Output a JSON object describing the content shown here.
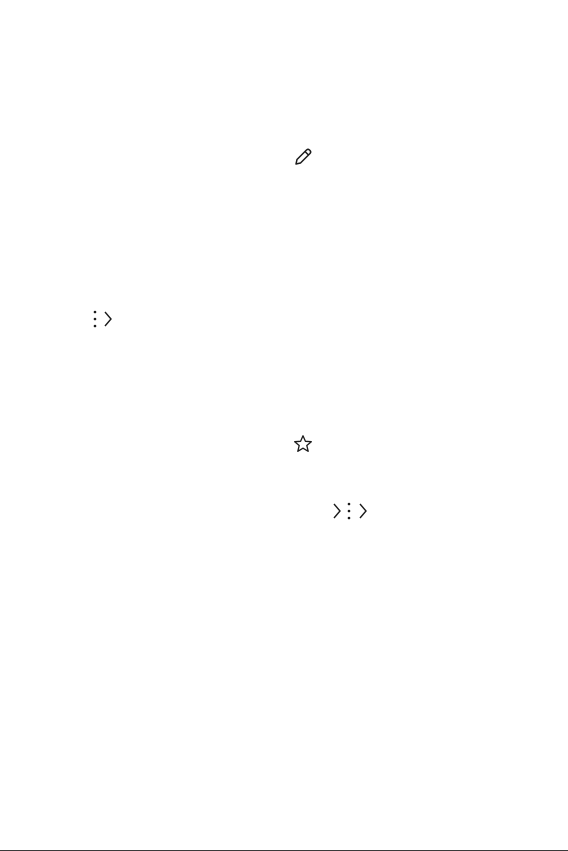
{
  "colors": {
    "background": "#ffffff",
    "icon": "#1a1a1a",
    "bottom_rule": "#3a3a3a"
  },
  "icons": [
    "pencil-icon",
    "more-vertical-icon",
    "chevron-right-icon",
    "star-outline-icon",
    "chevron-right-icon",
    "more-vertical-icon",
    "chevron-right-icon"
  ]
}
